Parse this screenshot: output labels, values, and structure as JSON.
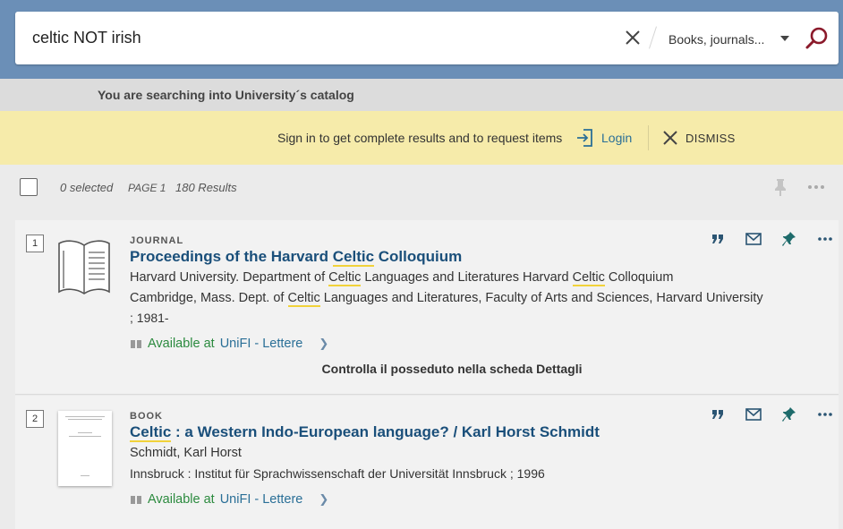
{
  "search": {
    "query": "celtic NOT irish",
    "scope": "Books, journals..."
  },
  "info": {
    "text": "You are searching into University´s catalog"
  },
  "signin": {
    "message": "Sign in to get complete results and to request items",
    "login_label": "Login",
    "dismiss_label": "DISMISS"
  },
  "toolbar": {
    "selected": "0 selected",
    "page": "PAGE 1",
    "results": "180 Results"
  },
  "results": [
    {
      "index": "1",
      "type": "JOURNAL",
      "title_pre": "Proceedings of the Harvard ",
      "title_hl": "Celtic",
      "title_post": " Colloquium",
      "line1_pre": "Harvard University. Department of ",
      "line1_hl": "Celtic",
      "line1_mid": " Languages and Literatures Harvard ",
      "line1_hl2": "Celtic",
      "line1_post": " Colloquium",
      "line2_pre": "Cambridge, Mass. Dept. of ",
      "line2_hl": "Celtic",
      "line2_post": " Languages and Literatures, Faculty of Arts and Sciences, Harvard University",
      "line3": "; 1981-",
      "avail": "Available at",
      "location": "UniFI - Lettere",
      "note": "Controlla il posseduto nella scheda Dettagli"
    },
    {
      "index": "2",
      "type": "BOOK",
      "title_hl": "Celtic",
      "title_post": " : a Western Indo-European language? / Karl Horst Schmidt",
      "author": "Schmidt, Karl Horst",
      "publisher": "Innsbruck : Institut für Sprachwissenschaft der Universität Innsbruck ; 1996",
      "avail": "Available at",
      "location": "UniFI - Lettere"
    }
  ],
  "colors": {
    "topband": "#6b8fb7",
    "signin_bg": "#f6ebaa",
    "title": "#1a4f7a",
    "available": "#2b8a3e",
    "highlight": "#f1d23a"
  }
}
